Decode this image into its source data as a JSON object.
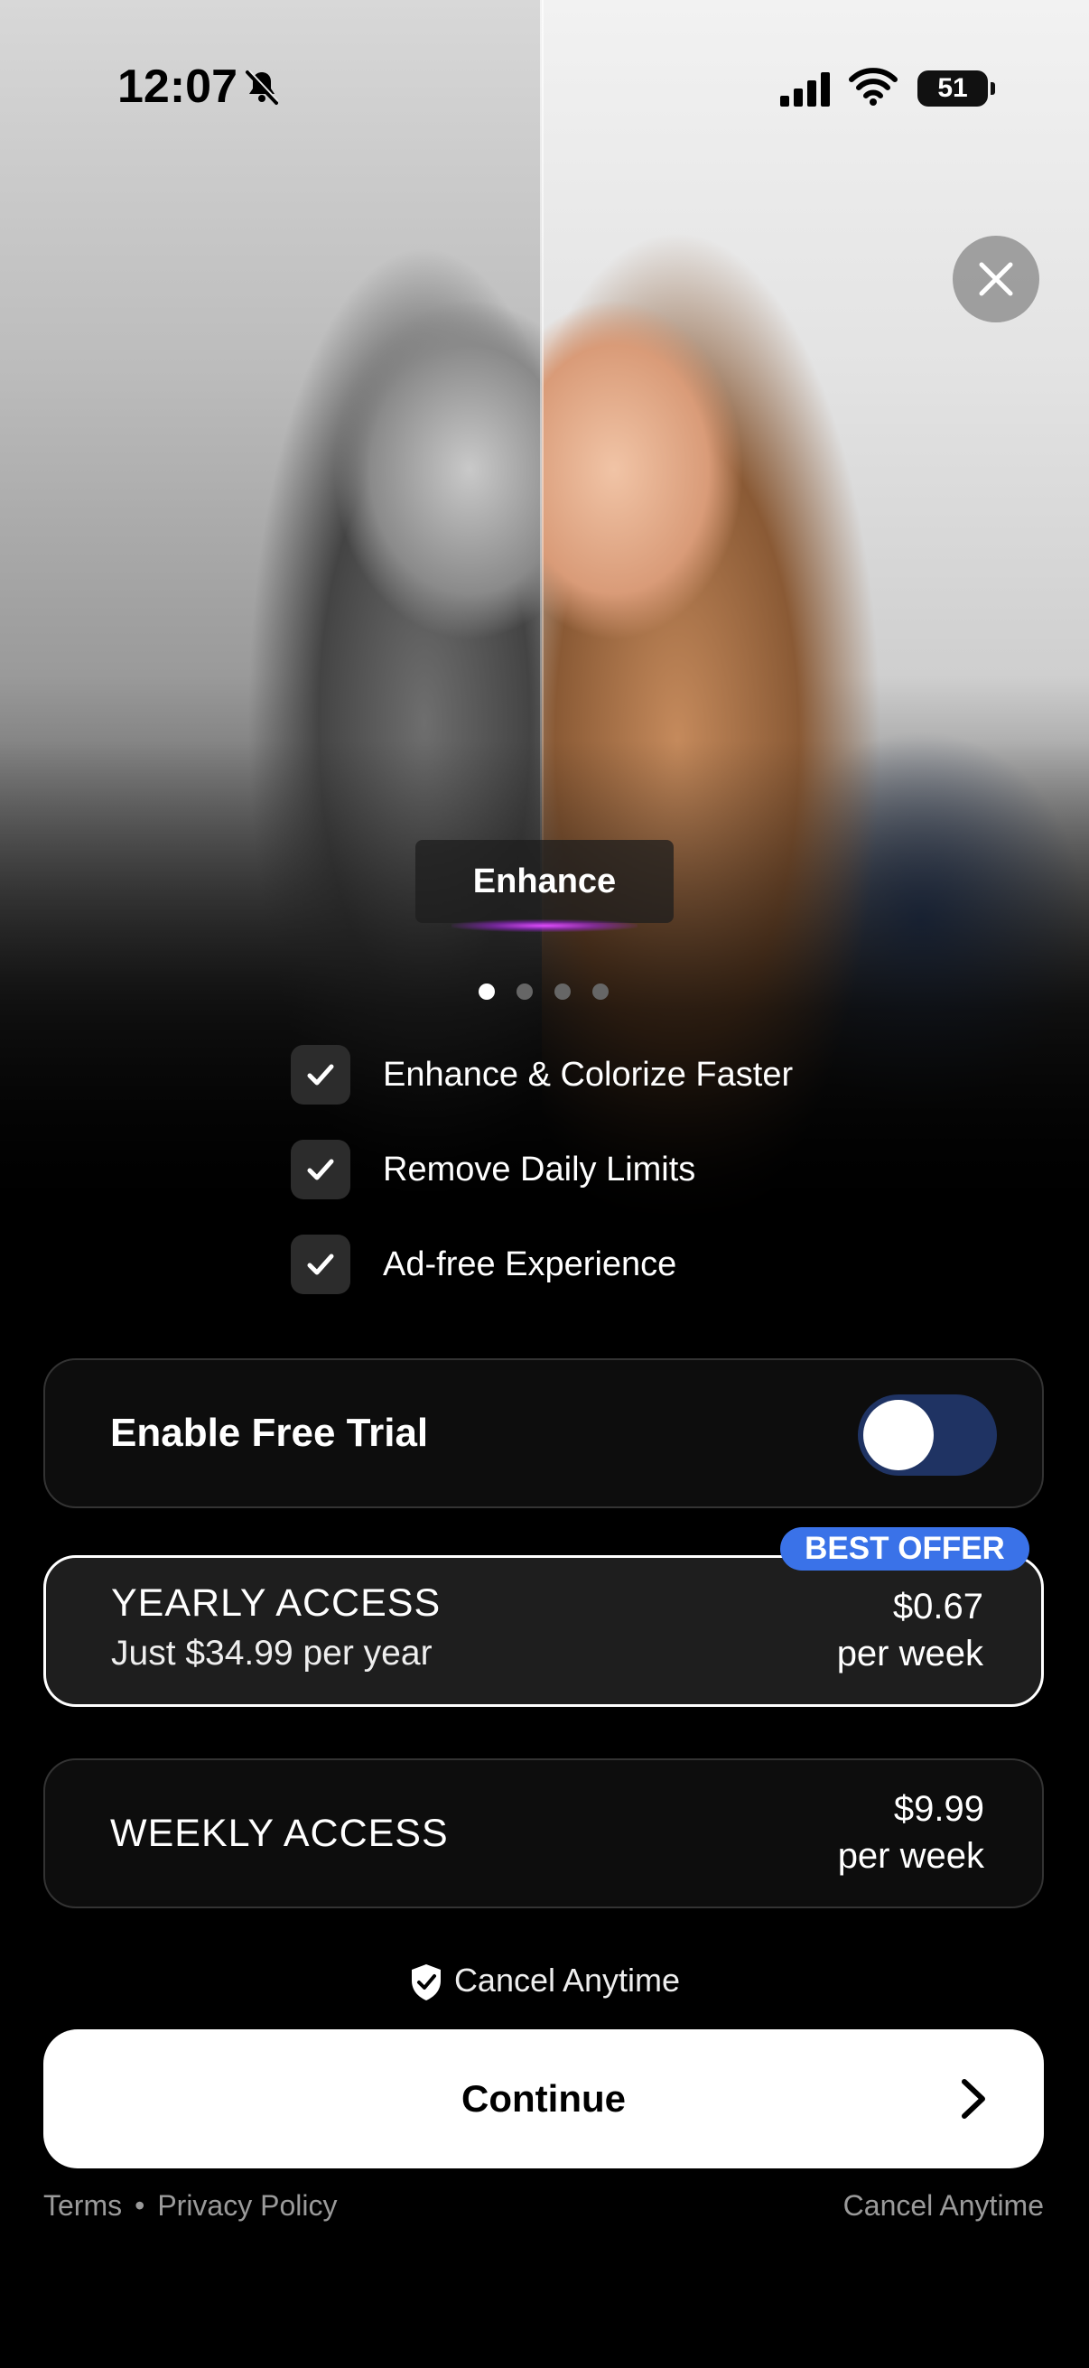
{
  "status_bar": {
    "time": "12:07",
    "battery": "51"
  },
  "hero": {
    "tab_label": "Enhance",
    "page_count": 4,
    "active_page": 0
  },
  "features": [
    {
      "label": "Enhance & Colorize Faster"
    },
    {
      "label": "Remove Daily Limits"
    },
    {
      "label": "Ad-free Experience"
    }
  ],
  "trial": {
    "label": "Enable Free Trial",
    "enabled": true
  },
  "plans": {
    "yearly": {
      "badge": "BEST OFFER",
      "title": "YEARLY ACCESS",
      "subtitle": "Just $34.99 per year",
      "price": "$0.67",
      "period": "per week"
    },
    "weekly": {
      "title": "WEEKLY ACCESS",
      "price": "$9.99",
      "period": "per week"
    }
  },
  "cancel_note": "Cancel Anytime",
  "continue_label": "Continue",
  "footer": {
    "terms": "Terms",
    "separator": "•",
    "privacy": "Privacy Policy",
    "cancel": "Cancel Anytime"
  },
  "colors": {
    "accent_blue": "#3a72e8",
    "toggle_track": "#1f3363",
    "glow": "#e04bff"
  }
}
